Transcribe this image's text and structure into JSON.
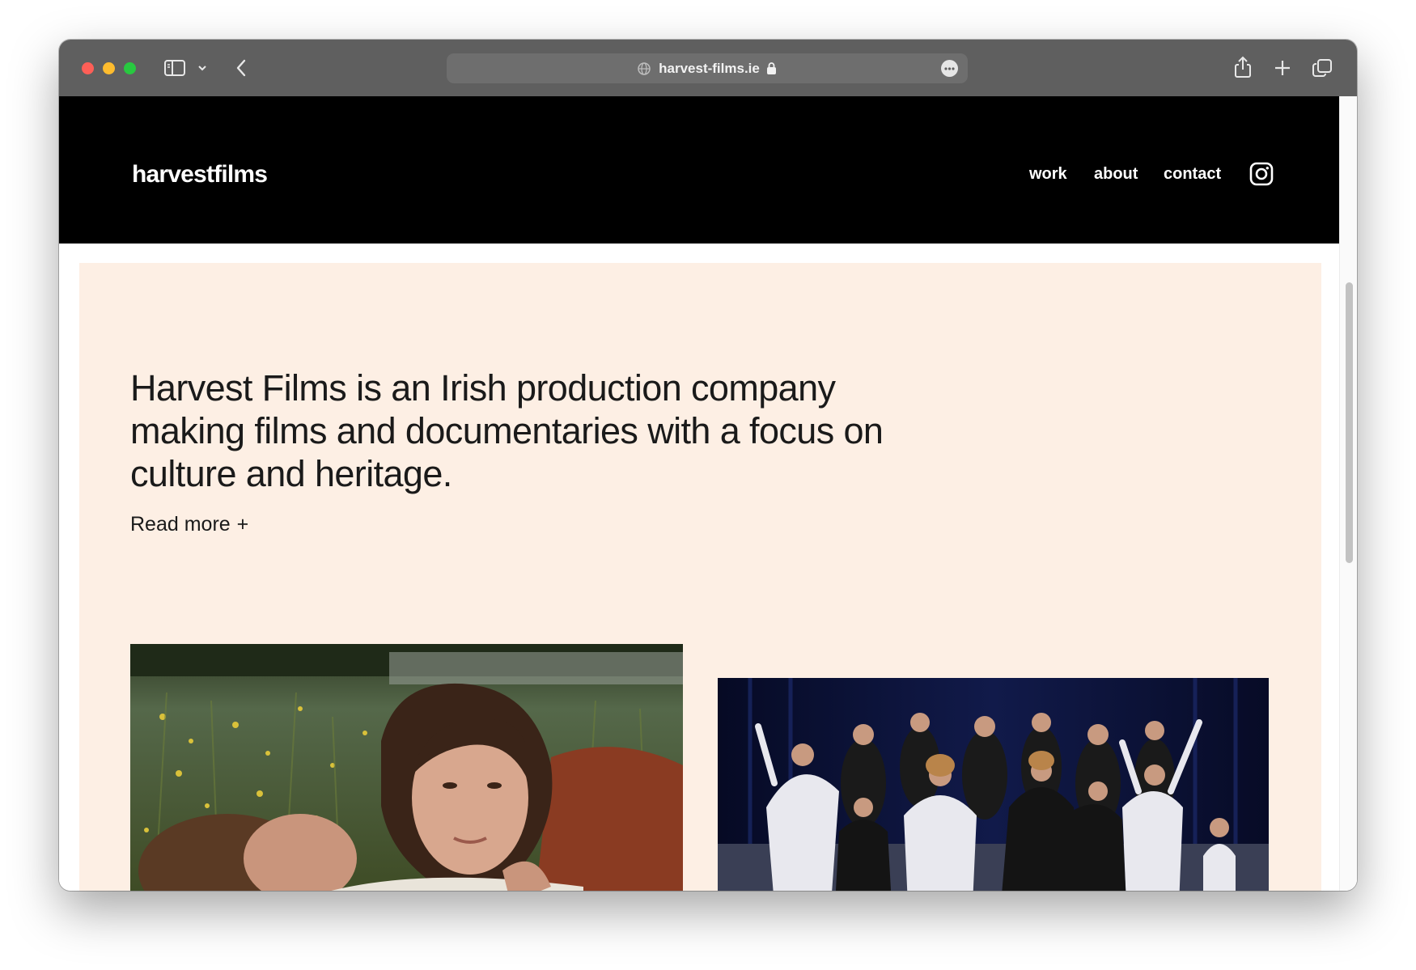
{
  "browser": {
    "url": "harvest-films.ie",
    "icons": {
      "sidebar": "sidebar-toggle-icon",
      "tab_overview": "chevron-down-icon",
      "back": "chevron-left-icon",
      "site": "globe-icon",
      "secure": "lock-icon",
      "more": "ellipsis-icon",
      "share": "share-icon",
      "new_tab": "plus-icon",
      "tabs": "tab-overview-icon"
    },
    "colors": {
      "toolbar": "#5f5f5f",
      "close": "#fe5f57",
      "minimize": "#febc2e",
      "maximize": "#28c840"
    }
  },
  "site": {
    "logo": "harvestfilms",
    "nav": [
      {
        "label": "work"
      },
      {
        "label": "about"
      },
      {
        "label": "contact"
      }
    ],
    "social_icon": "instagram-icon",
    "colors": {
      "header_bg": "#000000",
      "hero_bg": "#fdefe4",
      "text": "#1a1a1a"
    }
  },
  "hero": {
    "headline": "Harvest Films is an Irish production company making films and documentaries with a focus on culture and heritage.",
    "read_more": "Read more",
    "read_more_icon": "+"
  }
}
